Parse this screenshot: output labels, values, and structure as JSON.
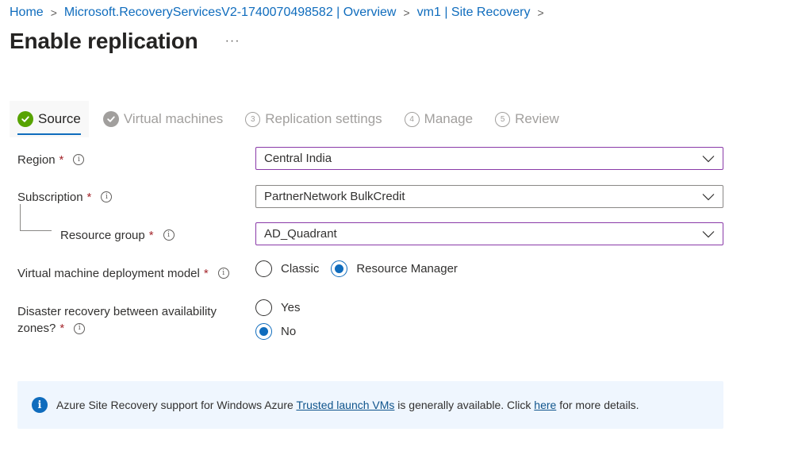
{
  "breadcrumb": [
    {
      "label": "Home"
    },
    {
      "label": "Microsoft.RecoveryServicesV2-1740070498582 | Overview"
    },
    {
      "label": "vm1 | Site Recovery"
    }
  ],
  "breadcrumb_separator": ">",
  "header": {
    "title": "Enable replication",
    "more_label": "···"
  },
  "tabs": [
    {
      "label": "Source",
      "state": "completed-active",
      "icon": "check-circle-green-icon"
    },
    {
      "label": "Virtual machines",
      "state": "completed",
      "icon": "check-circle-grey-icon"
    },
    {
      "label": "Replication settings",
      "state": "pending",
      "step": "3"
    },
    {
      "label": "Manage",
      "state": "pending",
      "step": "4"
    },
    {
      "label": "Review",
      "state": "pending",
      "step": "5"
    }
  ],
  "form": {
    "required_marker": "*",
    "info_glyph": "i",
    "region": {
      "label": "Region",
      "value": "Central India"
    },
    "subscription": {
      "label": "Subscription",
      "value": "PartnerNetwork BulkCredit"
    },
    "resource_group": {
      "label": "Resource group",
      "value": "AD_Quadrant"
    },
    "deployment_model": {
      "label": "Virtual machine deployment model",
      "options": [
        {
          "label": "Classic",
          "checked": false
        },
        {
          "label": "Resource Manager",
          "checked": true
        }
      ]
    },
    "availability_zones": {
      "label_line1": "Disaster recovery between availability",
      "label_line2": "zones?",
      "options": [
        {
          "label": "Yes",
          "checked": false
        },
        {
          "label": "No",
          "checked": true
        }
      ]
    }
  },
  "notice": {
    "icon_glyph": "i",
    "text_before": "Azure Site Recovery support for Windows Azure ",
    "link1": "Trusted launch VMs",
    "text_middle": " is generally available. Click ",
    "link2": "here",
    "text_after": " for more details."
  },
  "colors": {
    "link": "#0f6cbd",
    "success": "#57a300",
    "focus_border": "#8a3aa8",
    "required": "#a4262c",
    "notice_bg": "#eff6fe"
  }
}
